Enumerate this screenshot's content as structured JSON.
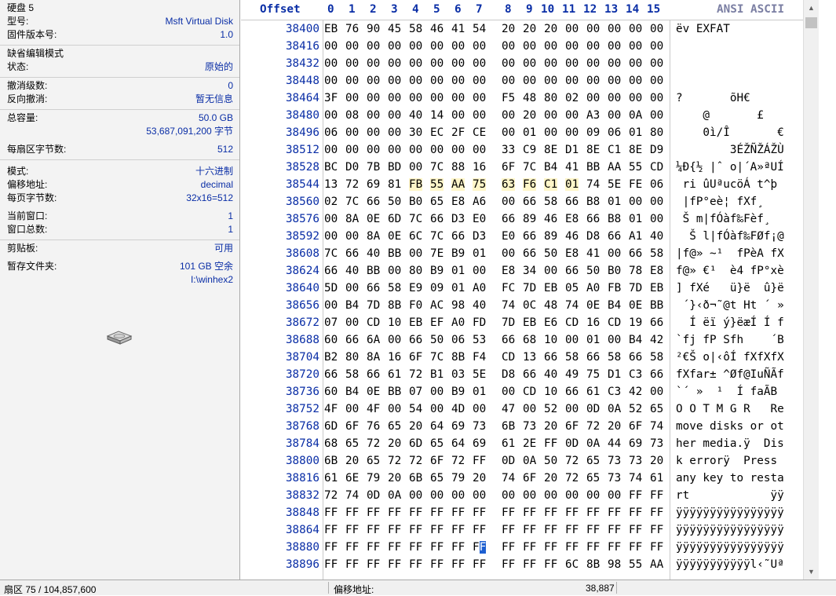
{
  "info": {
    "disk_name": "硬盘 5",
    "model_label": "型号:",
    "model_value": "Msft Virtual Disk",
    "firmware_label": "固件版本号:",
    "firmware_value": "1.0",
    "edit_mode_title": "缺省编辑模式",
    "state_label": "状态:",
    "state_value": "原始的",
    "undo_label": "撤消级数:",
    "undo_value": "0",
    "redo_label": "反向撤消:",
    "redo_value": "暂无信息",
    "capacity_label": "总容量:",
    "capacity_value": "50.0 GB",
    "capacity_bytes": "53,687,091,200 字节",
    "bps_label": "每扇区字节数:",
    "bps_value": "512",
    "mode_label": "模式:",
    "mode_value": "十六进制",
    "offset_label": "偏移地址:",
    "offset_value": "decimal",
    "bpp_label": "每页字节数:",
    "bpp_value": "32x16=512",
    "curwin_label": "当前窗口:",
    "curwin_value": "1",
    "totwin_label": "窗口总数:",
    "totwin_value": "1",
    "clip_label": "剪贴板:",
    "clip_value": "可用",
    "temp_label": "暂存文件夹:",
    "temp_value": "101 GB 空余",
    "temp_path": "I:\\winhex2"
  },
  "header": {
    "offset": "Offset",
    "ansi": "ANSI ASCII",
    "cols": [
      "0",
      "1",
      "2",
      "3",
      "4",
      "5",
      "6",
      "7",
      "8",
      "9",
      "10",
      "11",
      "12",
      "13",
      "14",
      "15"
    ]
  },
  "rows": [
    {
      "o": "38400",
      "h": "EB 76 90 45 58 46 41 54 20 20 20 00 00 00 00 00",
      "t": "ëv EXFAT"
    },
    {
      "o": "38416",
      "h": "00 00 00 00 00 00 00 00 00 00 00 00 00 00 00 00",
      "t": ""
    },
    {
      "o": "38432",
      "h": "00 00 00 00 00 00 00 00 00 00 00 00 00 00 00 00",
      "t": ""
    },
    {
      "o": "38448",
      "h": "00 00 00 00 00 00 00 00 00 00 00 00 00 00 00 00",
      "t": ""
    },
    {
      "o": "38464",
      "h": "3F 00 00 00 00 00 00 00 F5 48 80 02 00 00 00 00",
      "t": "?       õH€"
    },
    {
      "o": "38480",
      "h": "00 08 00 00 40 14 00 00 00 20 00 00 A3 00 0A 00",
      "t": "    @       £"
    },
    {
      "o": "38496",
      "h": "06 00 00 00 30 EC 2F CE 00 01 00 00 09 06 01 80",
      "t": "    0ì/Î       €"
    },
    {
      "o": "38512",
      "h": "00 00 00 00 00 00 00 00 33 C9 8E D1 8E C1 8E D9",
      "t": "        3ÉŽÑŽÁŽÙ"
    },
    {
      "o": "38528",
      "h": "BC D0 7B BD 00 7C 88 16 6F 7C B4 41 BB AA 55 CD",
      "t": "¼Ð{½ |ˆ o|´A»ªUÍ"
    },
    {
      "o": "38544",
      "h": "13 72 69 81 FB 55 AA 75 63 F6 C1 01 74 5E FE 06",
      "t": " ri ûUªucöÁ t^þ"
    },
    {
      "o": "38560",
      "h": "02 7C 66 50 B0 65 E8 A6 00 66 58 66 B8 01 00 00",
      "t": " |fP°eè¦ fXf¸"
    },
    {
      "o": "38576",
      "h": "00 8A 0E 6D 7C 66 D3 E0 66 89 46 E8 66 B8 01 00",
      "t": " Š m|fÓàf‰Fèf¸"
    },
    {
      "o": "38592",
      "h": "00 00 8A 0E 6C 7C 66 D3 E0 66 89 46 D8 66 A1 40",
      "t": "  Š l|fÓàf‰FØf¡@"
    },
    {
      "o": "38608",
      "h": "7C 66 40 BB 00 7E B9 01 00 66 50 E8 41 00 66 58",
      "t": "|f@» ~¹  fPèA fX"
    },
    {
      "o": "38624",
      "h": "66 40 BB 00 80 B9 01 00 E8 34 00 66 50 B0 78 E8",
      "t": "f@» €¹  è4 fP°xè"
    },
    {
      "o": "38640",
      "h": "5D 00 66 58 E9 09 01 A0 FC 7D EB 05 A0 FB 7D EB",
      "t": "] fXé   ü}ë  û}ë"
    },
    {
      "o": "38656",
      "h": "00 B4 7D 8B F0 AC 98 40 74 0C 48 74 0E B4 0E BB",
      "t": " ´}‹ð¬˜@t Ht ´ »"
    },
    {
      "o": "38672",
      "h": "07 00 CD 10 EB EF A0 FD 7D EB E6 CD 16 CD 19 66",
      "t": "  Í ëï ý}ëæÍ Í f"
    },
    {
      "o": "38688",
      "h": "60 66 6A 00 66 50 06 53 66 68 10 00 01 00 B4 42",
      "t": "`fj fP Sfh    ´B"
    },
    {
      "o": "38704",
      "h": "B2 80 8A 16 6F 7C 8B F4 CD 13 66 58 66 58 66 58",
      "t": "²€Š o|‹ôÍ fXfXfX"
    },
    {
      "o": "38720",
      "h": "66 58 66 61 72 B1 03 5E D8 66 40 49 75 D1 C3 66",
      "t": "fXfar± ^Øf@IuÑÃf"
    },
    {
      "o": "38736",
      "h": "60 B4 0E BB 07 00 B9 01 00 CD 10 66 61 C3 42 00",
      "t": "`´ »  ¹  Í faÃB"
    },
    {
      "o": "38752",
      "h": "4F 00 4F 00 54 00 4D 00 47 00 52 00 0D 0A 52 65",
      "t": "O O T M G R   Re"
    },
    {
      "o": "38768",
      "h": "6D 6F 76 65 20 64 69 73 6B 73 20 6F 72 20 6F 74",
      "t": "move disks or ot"
    },
    {
      "o": "38784",
      "h": "68 65 72 20 6D 65 64 69 61 2E FF 0D 0A 44 69 73",
      "t": "her media.ÿ  Dis"
    },
    {
      "o": "38800",
      "h": "6B 20 65 72 72 6F 72 FF 0D 0A 50 72 65 73 73 20",
      "t": "k errorÿ  Press "
    },
    {
      "o": "38816",
      "h": "61 6E 79 20 6B 65 79 20 74 6F 20 72 65 73 74 61",
      "t": "any key to resta"
    },
    {
      "o": "38832",
      "h": "72 74 0D 0A 00 00 00 00 00 00 00 00 00 00 FF FF",
      "t": "rt            ÿÿ"
    },
    {
      "o": "38848",
      "h": "FF FF FF FF FF FF FF FF FF FF FF FF FF FF FF FF",
      "t": "ÿÿÿÿÿÿÿÿÿÿÿÿÿÿÿÿ"
    },
    {
      "o": "38864",
      "h": "FF FF FF FF FF FF FF FF FF FF FF FF FF FF FF FF",
      "t": "ÿÿÿÿÿÿÿÿÿÿÿÿÿÿÿÿ"
    },
    {
      "o": "38880",
      "h": "FF FF FF FF FF FF FF FF FF FF FF FF FF FF FF FF",
      "t": "ÿÿÿÿÿÿÿÿÿÿÿÿÿÿÿÿ"
    },
    {
      "o": "38896",
      "h": "FF FF FF FF FF FF FF FF FF FF FF 6C 8B 98 55 AA",
      "t": "ÿÿÿÿÿÿÿÿÿÿÿl‹˜Uª"
    }
  ],
  "highlight": {
    "row": 9,
    "from": 4,
    "to": 11
  },
  "cursor": {
    "row": 30,
    "col": 7
  },
  "status": {
    "sector": "扇区 75 / 104,857,600",
    "offset_label": "偏移地址:",
    "offset_value": "38,887"
  },
  "colors": {
    "offset_blue": "#0a2ea6",
    "highlight": "#fff6c9",
    "cursor": "#1d5fd1"
  }
}
